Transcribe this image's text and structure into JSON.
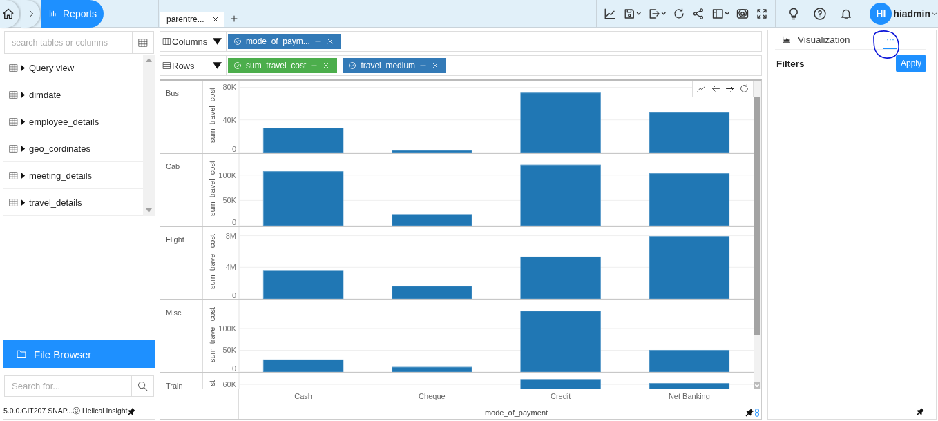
{
  "breadcrumb": {
    "current": "Reports"
  },
  "report_tabs": [
    {
      "label": "parentre...",
      "selected": true
    }
  ],
  "user": {
    "initials": "HI",
    "name": "hiadmin"
  },
  "sidebar": {
    "search": {
      "placeholder": "search tables or columns"
    },
    "items": [
      {
        "label": "Query view",
        "expanded": false
      },
      {
        "label": "dimdate",
        "expanded": false
      },
      {
        "label": "employee_details",
        "expanded": false
      },
      {
        "label": "geo_cordinates",
        "expanded": false
      },
      {
        "label": "meeting_details",
        "expanded": false
      },
      {
        "label": "travel_details",
        "expanded": false
      }
    ],
    "file_browser": "File Browser",
    "file_search": {
      "placeholder": "Search for..."
    },
    "footer": "5.0.0.GIT207 SNAP...ⓒ Helical Insight"
  },
  "shelves": [
    {
      "label": "Columns",
      "kind": "columns",
      "fields": [
        {
          "label": "mode_of_paym...",
          "color": "#337ab7"
        }
      ]
    },
    {
      "label": "Rows",
      "kind": "rows",
      "fields": [
        {
          "label": "sum_travel_cost",
          "color": "#4cae4c"
        },
        {
          "label": "travel_medium",
          "color": "#337ab7"
        }
      ]
    }
  ],
  "chart": {
    "xlabel": "mode_of_payment",
    "categories": [
      "Cash",
      "Cheque",
      "Credit",
      "Net Banking"
    ],
    "panels": [
      {
        "label": "Bus",
        "chart_data": {
          "type": "bar",
          "ylabel": "sum_travel_cost",
          "ylim": [
            0,
            88000
          ],
          "yticks": [
            {
              "value": 0,
              "label": "0"
            },
            {
              "value": 40000,
              "label": "40K"
            },
            {
              "value": 80000,
              "label": "80K"
            }
          ],
          "values": [
            30000,
            2500,
            73000,
            49000
          ]
        }
      },
      {
        "label": "Cab",
        "chart_data": {
          "type": "bar",
          "ylabel": "sum_travel_cost",
          "ylim": [
            0,
            142000
          ],
          "yticks": [
            {
              "value": 0,
              "label": "0"
            },
            {
              "value": 50000,
              "label": "50K"
            },
            {
              "value": 100000,
              "label": "100K"
            }
          ],
          "values": [
            107000,
            22000,
            120000,
            103000
          ]
        }
      },
      {
        "label": "Flight",
        "chart_data": {
          "type": "bar",
          "ylabel": "sum_travel_cost",
          "ylim": [
            0,
            9100000
          ],
          "yticks": [
            {
              "value": 0,
              "label": "0"
            },
            {
              "value": 4000000,
              "label": "4M"
            },
            {
              "value": 8000000,
              "label": "8M"
            }
          ],
          "values": [
            3600000,
            1600000,
            5300000,
            7900000
          ]
        }
      },
      {
        "label": "Misc",
        "chart_data": {
          "type": "bar",
          "ylabel": "sum_travel_cost",
          "ylim": [
            0,
            165000
          ],
          "yticks": [
            {
              "value": 0,
              "label": "0"
            },
            {
              "value": 50000,
              "label": "50K"
            },
            {
              "value": 100000,
              "label": "100K"
            }
          ],
          "values": [
            28000,
            11000,
            140000,
            50000
          ]
        }
      },
      {
        "label": "Train",
        "chart_data": {
          "type": "bar",
          "ylabel": "st",
          "ylim": [
            0,
            71000
          ],
          "yticks": [
            {
              "value": 60000,
              "label": "60K"
            }
          ],
          "values": [
            null,
            null,
            65000,
            61000
          ]
        }
      }
    ]
  },
  "right_panel": {
    "tabs": [
      {
        "label": "Visualization",
        "kind": "visualization",
        "selected": false
      },
      {
        "label": "···",
        "kind": "more",
        "selected": true
      }
    ],
    "filters_title": "Filters",
    "apply": "Apply"
  }
}
